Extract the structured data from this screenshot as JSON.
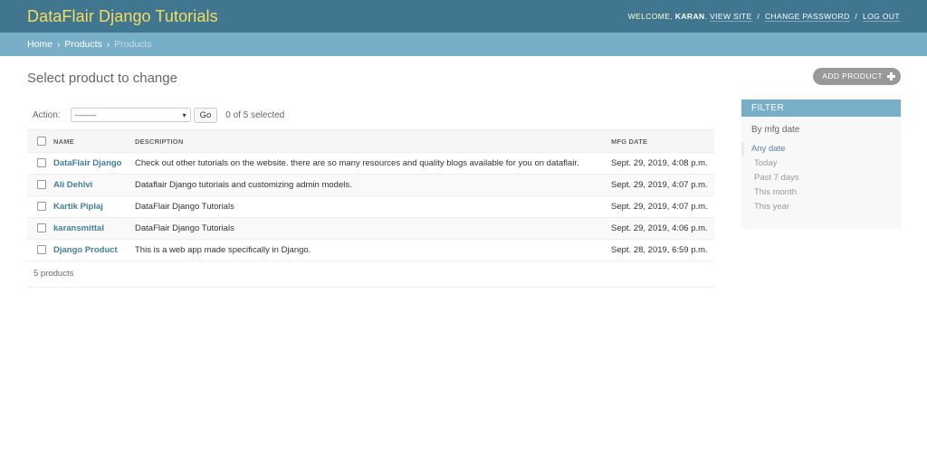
{
  "header": {
    "brand": "DataFlair Django Tutorials",
    "welcome": "Welcome,",
    "username": "Karan",
    "view_site": "View site",
    "change_password": "Change password",
    "log_out": "Log out",
    "separator": "/"
  },
  "breadcrumbs": {
    "home": "Home",
    "products": "Products",
    "current": "Products",
    "separator": "›"
  },
  "page": {
    "title": "Select product to change",
    "add_button": "Add product"
  },
  "actions": {
    "label": "Action:",
    "select_value": "---------",
    "go_label": "Go",
    "selected_count": "0 of 5 selected"
  },
  "table": {
    "headers": {
      "name": "Name",
      "description": "Description",
      "mfg_date": "MFG Date"
    },
    "rows": [
      {
        "name": "DataFlair Django",
        "description": "Check out other tutorials on the website. there are so many resources and quality blogs available for you on dataflair.",
        "mfg_date": "Sept. 29, 2019, 4:08 p.m."
      },
      {
        "name": "Ali Dehlvi",
        "description": "Dataflair Django tutorials and customizing admin models.",
        "mfg_date": "Sept. 29, 2019, 4:07 p.m."
      },
      {
        "name": "Kartik Piplaj",
        "description": "DataFlair Django Tutorials",
        "mfg_date": "Sept. 29, 2019, 4:07 p.m."
      },
      {
        "name": "karansmittal",
        "description": "DataFlair Django Tutorials",
        "mfg_date": "Sept. 29, 2019, 4:06 p.m."
      },
      {
        "name": "Django Product",
        "description": "This is a web app made specifically in Django.",
        "mfg_date": "Sept. 28, 2019, 6:59 p.m."
      }
    ]
  },
  "paginator": {
    "text": "5 products"
  },
  "filter": {
    "header": "Filter",
    "title": "By mfg date",
    "options": [
      "Any date",
      "Today",
      "Past 7 days",
      "This month",
      "This year"
    ],
    "selected": "Any date"
  },
  "colors": {
    "header_bg": "#417690",
    "brand": "#f5dd5d",
    "breadcrumb_bg": "#79aec8",
    "link": "#447e9b",
    "filter_selected": "#5b80b2"
  }
}
